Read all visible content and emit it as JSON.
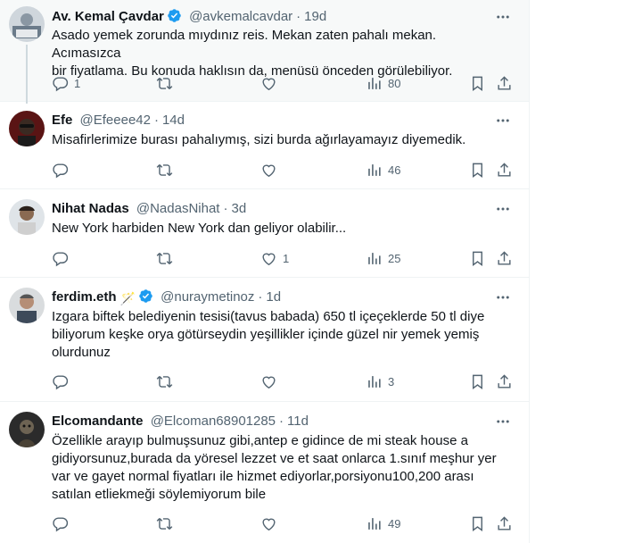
{
  "tweets": [
    {
      "name": "Av. Kemal Çavdar",
      "verified": true,
      "handle": "@avkemalcavdar",
      "time": "19d",
      "text": "Asado yemek zorunda mıydınız reis. Mekan zaten pahalı mekan. Acımasızca\nbir fiyatlama. Bu konuda haklısın da, menüsü önceden görülebiliyor.",
      "replies": "1",
      "retweets": "",
      "likes": "",
      "views": "80",
      "highlighted": true
    },
    {
      "name": "Efe",
      "verified": false,
      "handle": "@Efeeee42",
      "time": "14d",
      "text": "Misafirlerimize burası pahalıymış, sizi burda ağırlayamayız diyemedik.",
      "replies": "",
      "retweets": "",
      "likes": "",
      "views": "46",
      "highlighted": false
    },
    {
      "name": "Nihat Nadas",
      "verified": false,
      "handle": "@NadasNihat",
      "time": "3d",
      "text": "New York harbiden New York dan geliyor olabilir...",
      "replies": "",
      "retweets": "",
      "likes": "1",
      "views": "25",
      "highlighted": false
    },
    {
      "name": "ferdim.eth",
      "name_emoji": "🪄",
      "verified": true,
      "handle": "@nuraymetinoz",
      "time": "1d",
      "text": "Izgara biftek belediyenin tesisi(tavus babada) 650 tl içeçeklerde 50 tl diye\nbiliyorum keşke orya götürseydin yeşillikler içinde güzel nir yemek yemiş\nolurdunuz",
      "replies": "",
      "retweets": "",
      "likes": "",
      "views": "3",
      "highlighted": false
    },
    {
      "name": "Elcomandante",
      "verified": false,
      "handle": "@Elcoman68901285",
      "time": "11d",
      "text": "Özellikle arayıp bulmuşsunuz gibi,antep e gidince de mi steak house a\ngidiyorsunuz,burada da yöresel lezzet ve et saat onlarca 1.sınıf meşhur yer\nvar ve gayet normal fiyatları ile hizmet ediyorlar,porsiyonu100,200 arası\nsatılan etliekmeği söylemiyorum bile",
      "replies": "",
      "retweets": "",
      "likes": "",
      "views": "49",
      "highlighted": false
    }
  ],
  "separator": "·",
  "colors": {
    "verified": "#1d9bf0",
    "secondary_text": "#536471",
    "border": "#eff3f4",
    "highlight_bg": "#f7f9f9"
  },
  "icons": [
    "reply-icon",
    "retweet-icon",
    "like-icon",
    "views-icon",
    "bookmark-icon",
    "share-icon",
    "more-icon",
    "verified-badge-icon"
  ]
}
